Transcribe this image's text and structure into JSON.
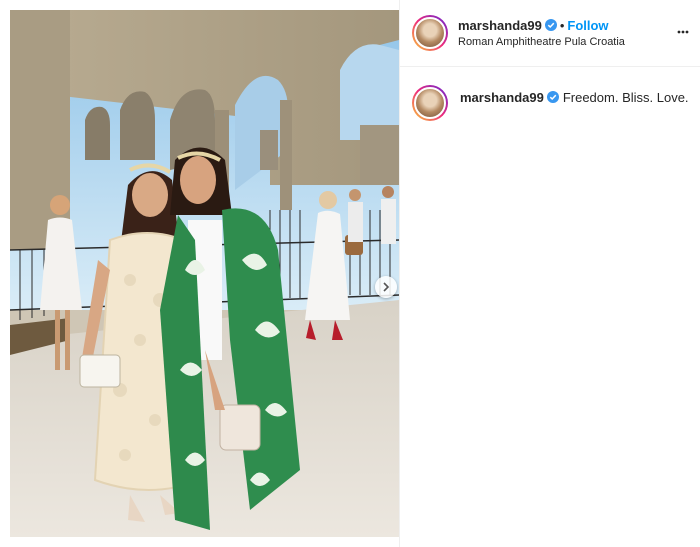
{
  "post": {
    "username": "marshanda99",
    "follow_label": "Follow",
    "separator": "•",
    "location": "Roman Amphitheatre Pula Croatia",
    "caption_text": "Freedom. Bliss. Love."
  },
  "icons": {
    "verified": "verified-badge-icon",
    "more": "more-options-icon",
    "next": "chevron-right-icon"
  },
  "colors": {
    "follow": "#0095f6",
    "verified": "#3897f0",
    "ring_start": "#f9ce34",
    "ring_end": "#6228d7"
  }
}
